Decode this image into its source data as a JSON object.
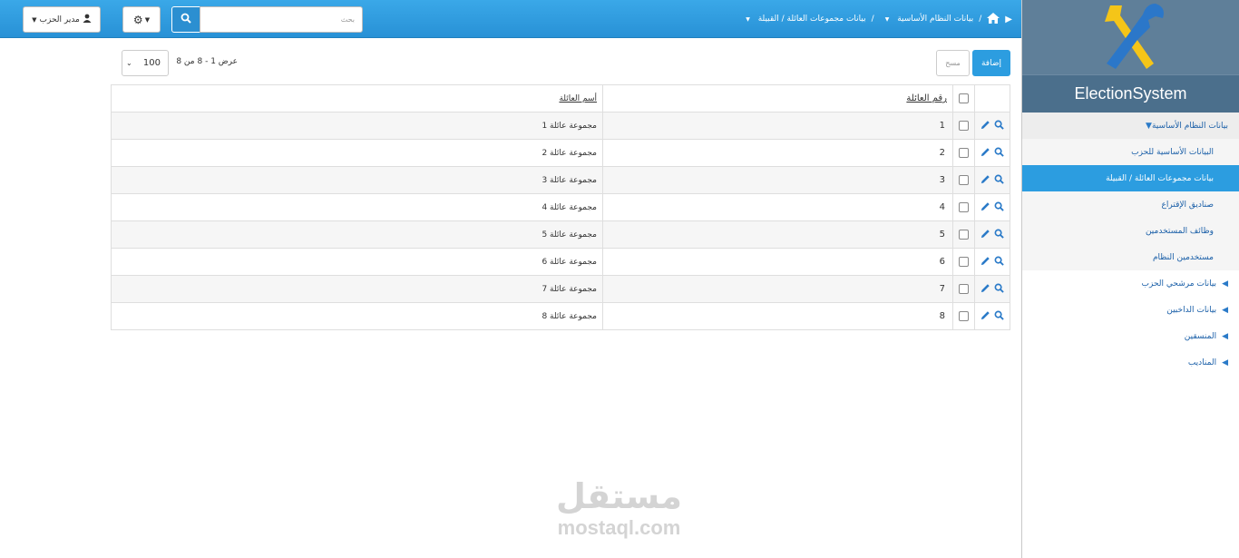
{
  "sidebar": {
    "brand": "ElectionSystem",
    "items": [
      {
        "label": "بيانات النظام الأساسية",
        "arrow": "▼"
      },
      {
        "label": "البيانات الأساسية للحزب"
      },
      {
        "label": "بيانات مجموعات العائلة / القبيلة"
      },
      {
        "label": "صناديق الإقتراع"
      },
      {
        "label": "وظائف المستخدمين"
      },
      {
        "label": "مستخدمين النظام"
      },
      {
        "label": "بيانات مرشحي الحزب",
        "arrow": "◀"
      },
      {
        "label": "بيانات الداخبين",
        "arrow": "◀"
      },
      {
        "label": "المنسقين",
        "arrow": "◀"
      },
      {
        "label": "المناديب",
        "arrow": "◀"
      }
    ]
  },
  "header": {
    "breadcrumb_level1": "بيانات النظام الأساسية",
    "breadcrumb_level2": "بيانات مجموعات العائلة / القبيلة",
    "separator": "/",
    "search_placeholder": "بحث",
    "user_label": "مدير الحزب"
  },
  "toolbar": {
    "add_label": "إضافة",
    "delete_label": "مسح",
    "page_size": "100",
    "pager_text": "عرض 1 - 8 من 8"
  },
  "table": {
    "columns": [
      "رقم العائلة",
      "أسم العائلة"
    ],
    "rows": [
      {
        "num": "1",
        "name": "مجموعة عائلة 1"
      },
      {
        "num": "2",
        "name": "مجموعة عائلة 2"
      },
      {
        "num": "3",
        "name": "مجموعة عائلة 3"
      },
      {
        "num": "4",
        "name": "مجموعة عائلة 4"
      },
      {
        "num": "5",
        "name": "مجموعة عائلة 5"
      },
      {
        "num": "6",
        "name": "مجموعة عائلة 6"
      },
      {
        "num": "7",
        "name": "مجموعة عائلة 7"
      },
      {
        "num": "8",
        "name": "مجموعة عائلة 8"
      }
    ]
  },
  "watermark": {
    "arabic": "مستقل",
    "latin": "mostaql.com"
  },
  "colors": {
    "accent": "#2c9de0",
    "topbar": "#3aa8e8",
    "logo_bg": "#5f7f99",
    "link": "#1a5fa8"
  }
}
